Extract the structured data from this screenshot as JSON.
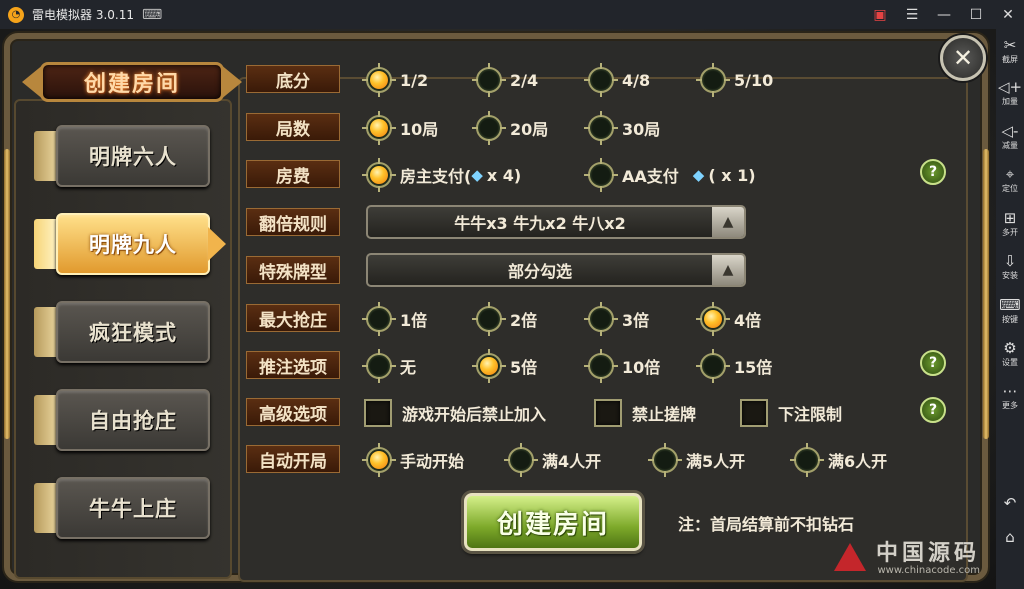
{
  "window": {
    "title": "雷电模拟器 3.0.11",
    "buttons": [
      "gift",
      "menu",
      "minimize",
      "maximize",
      "close"
    ]
  },
  "sidebar": {
    "items": [
      {
        "label": "截屏",
        "icon": "scissors-icon"
      },
      {
        "label": "加量",
        "icon": "volume-up-icon"
      },
      {
        "label": "减量",
        "icon": "volume-down-icon"
      },
      {
        "label": "定位",
        "icon": "location-pin-icon"
      },
      {
        "label": "多开",
        "icon": "multi-window-icon"
      },
      {
        "label": "安装",
        "icon": "apk-install-icon"
      },
      {
        "label": "按键",
        "icon": "keyboard-icon"
      },
      {
        "label": "设置",
        "icon": "gear-icon"
      },
      {
        "label": "更多",
        "icon": "more-icon"
      }
    ],
    "bottom": [
      "back-icon",
      "home-icon"
    ]
  },
  "header": {
    "title": "创建房间"
  },
  "tabs": [
    {
      "label": "明牌六人",
      "active": false
    },
    {
      "label": "明牌九人",
      "active": true
    },
    {
      "label": "疯狂模式",
      "active": false
    },
    {
      "label": "自由抢庄",
      "active": false
    },
    {
      "label": "牛牛上庄",
      "active": false
    }
  ],
  "rows": {
    "difen": {
      "label": "底分",
      "options": [
        "1/2",
        "2/4",
        "4/8",
        "5/10"
      ],
      "selected": 0
    },
    "jushu": {
      "label": "局数",
      "options": [
        "10局",
        "20局",
        "30局"
      ],
      "selected": 0
    },
    "fangfei": {
      "label": "房费",
      "options": [
        {
          "text": "房主支付(",
          "amount": "x 4)"
        },
        {
          "text": "AA支付",
          "amount": "(  x 1)"
        }
      ],
      "selected": 0
    },
    "fanbei": {
      "label": "翻倍规则",
      "value": "牛牛x3 牛九x2 牛八x2"
    },
    "teshu": {
      "label": "特殊牌型",
      "value": "部分勾选"
    },
    "qiangzhuang": {
      "label": "最大抢庄",
      "options": [
        "1倍",
        "2倍",
        "3倍",
        "4倍"
      ],
      "selected": 3
    },
    "tuizhu": {
      "label": "推注选项",
      "options": [
        "无",
        "5倍",
        "10倍",
        "15倍"
      ],
      "selected": 1
    },
    "gaoji": {
      "label": "高级选项",
      "checks": [
        "游戏开始后禁止加入",
        "禁止搓牌",
        "下注限制"
      ]
    },
    "zidong": {
      "label": "自动开局",
      "options": [
        "手动开始",
        "满4人开",
        "满5人开",
        "满6人开"
      ],
      "selected": 0
    }
  },
  "create_button": {
    "label": "创建房间"
  },
  "note": "注：首局结算前不扣钻石",
  "watermark": {
    "text": "中国源码",
    "url": "www.chinacode.com"
  },
  "colors": {
    "accent_gold": "#f1b44c",
    "selected_dot": "#ffc22a",
    "create_green": "#7da92a",
    "title_bar": "#22252b"
  }
}
